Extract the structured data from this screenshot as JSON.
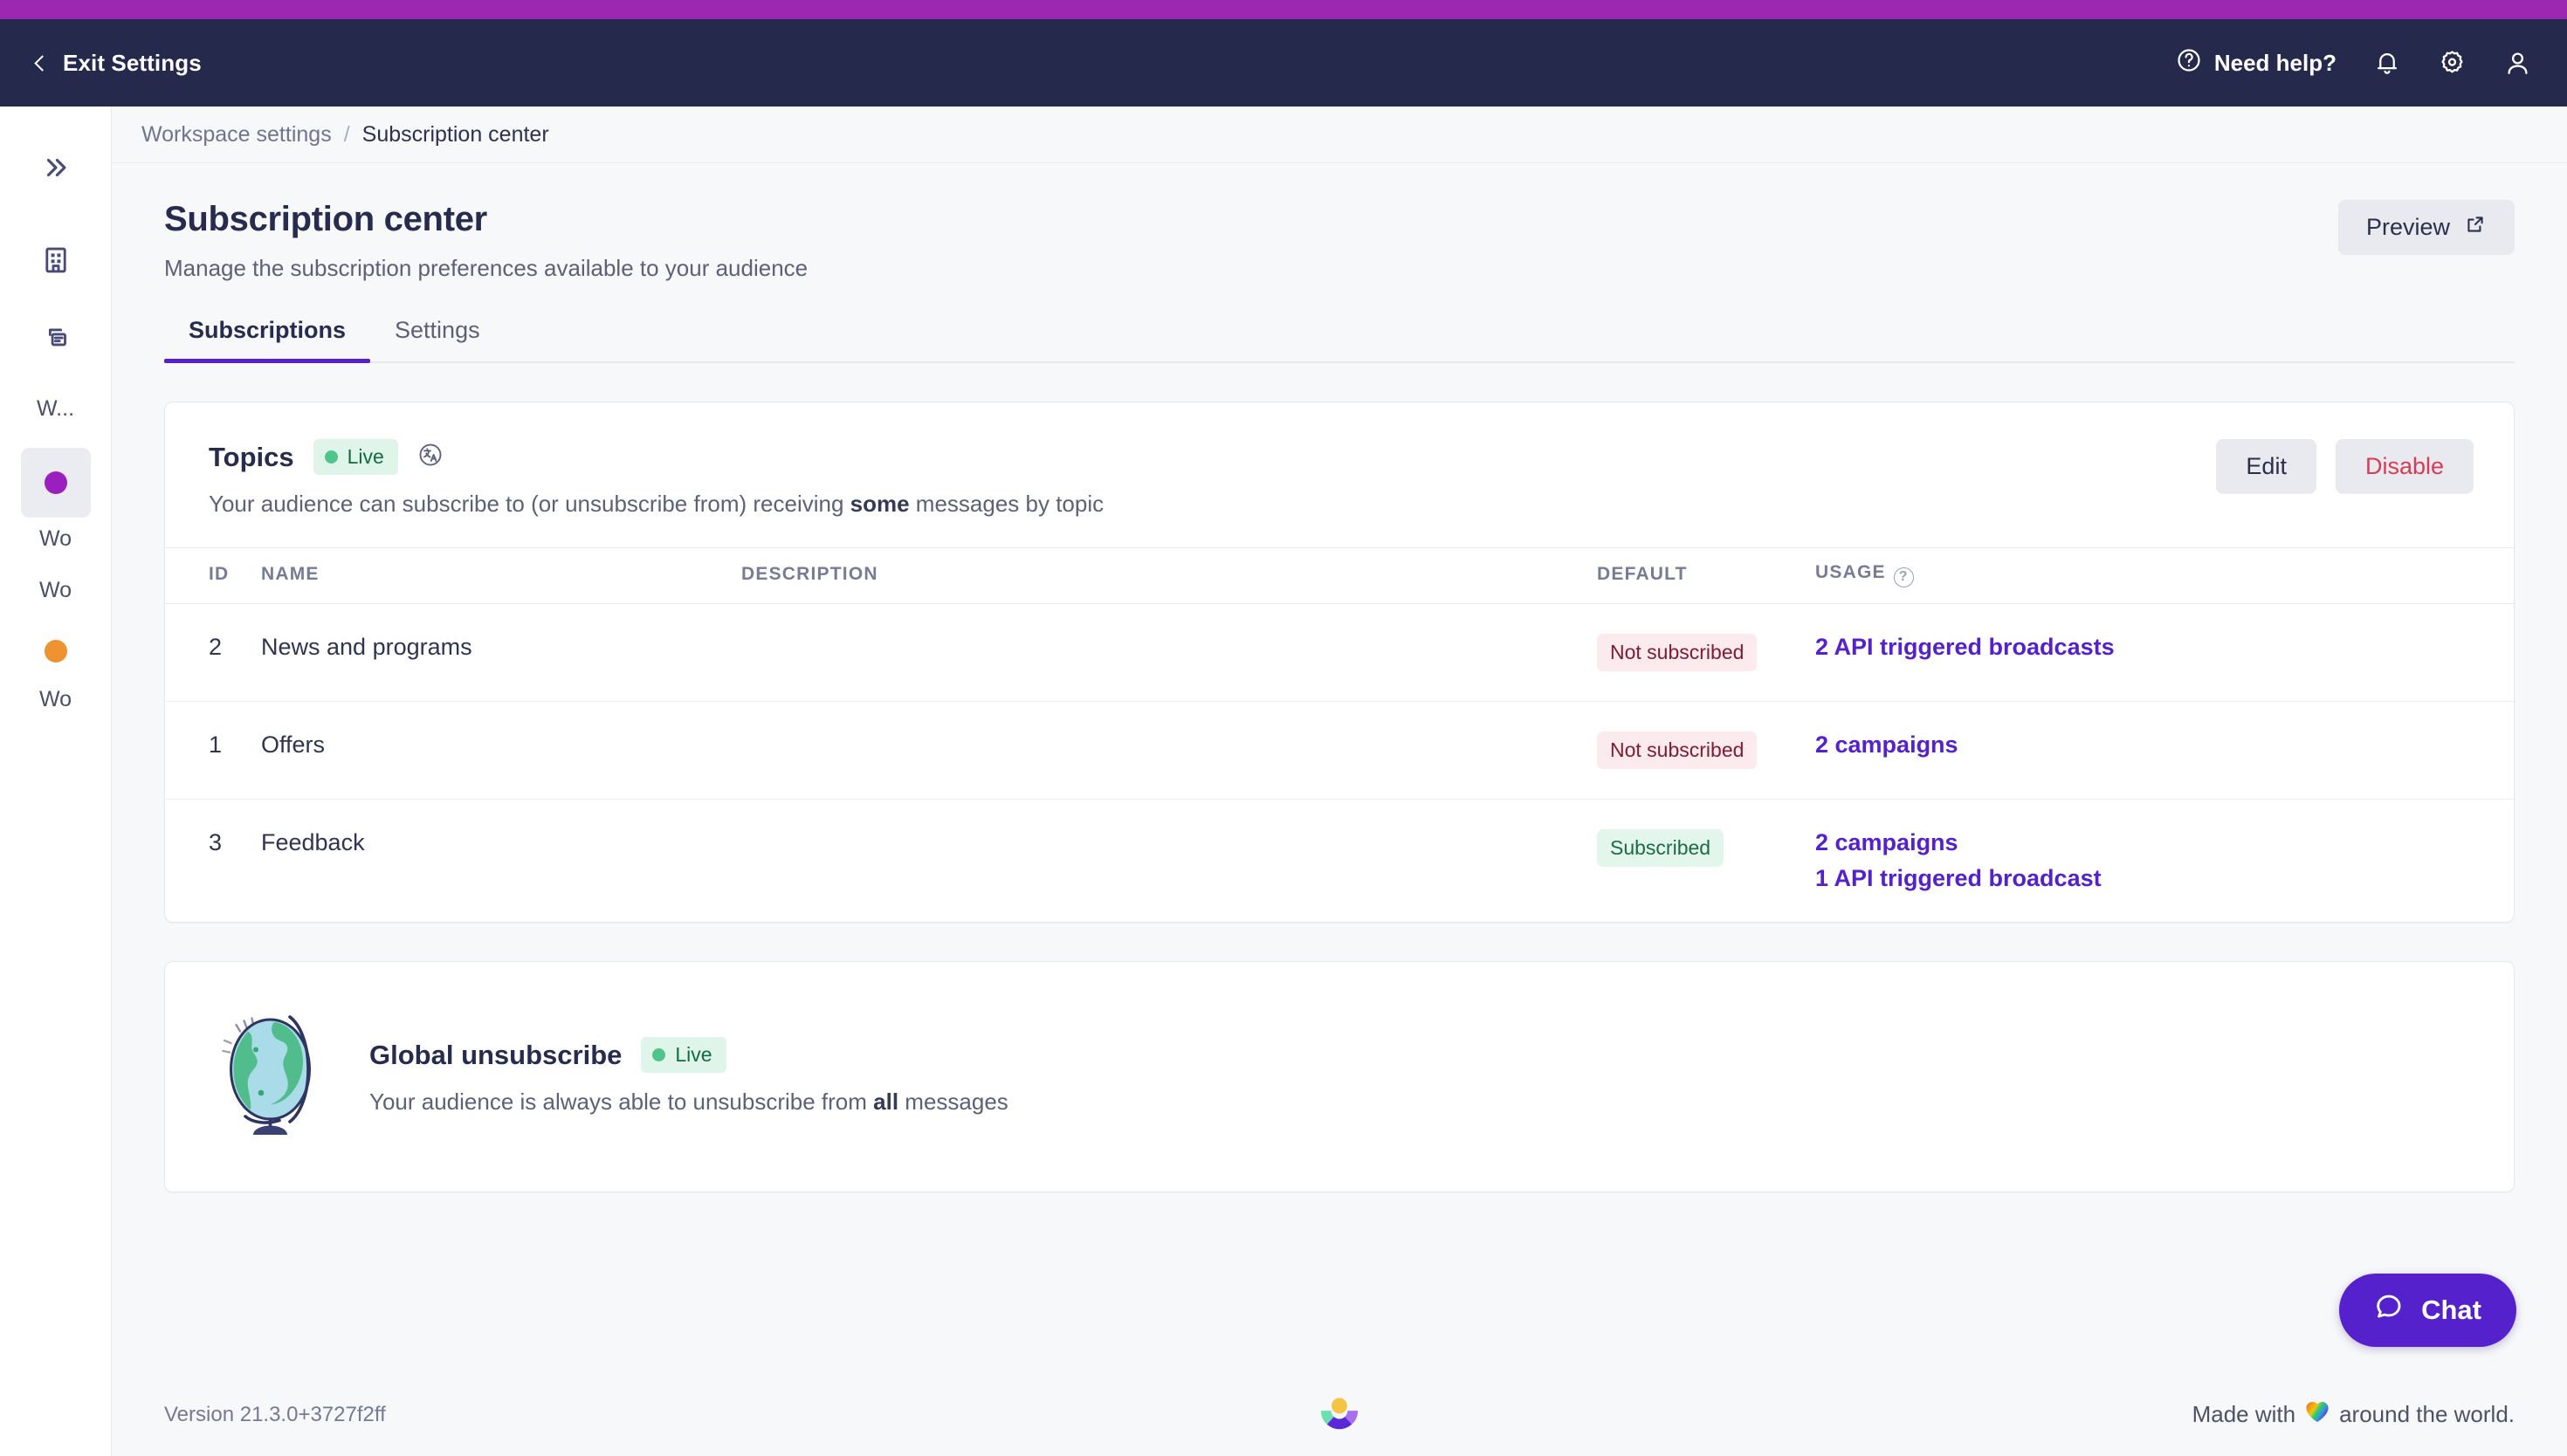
{
  "topnav": {
    "exit_label": "Exit Settings",
    "need_help_label": "Need help?",
    "icons": [
      "help-circle-icon",
      "bell-icon",
      "gear-icon",
      "user-icon"
    ]
  },
  "rail": {
    "collapse_label": "expand-sidebar",
    "items": [
      {
        "name": "building-icon",
        "label": ""
      },
      {
        "name": "copy-document-icon",
        "label": ""
      }
    ],
    "workspaces": [
      {
        "label": "W...",
        "dot": ""
      },
      {
        "label": "",
        "dot": "#9b1fbf",
        "active": true
      },
      {
        "label": "Wo"
      },
      {
        "label": "Wo"
      },
      {
        "label": "",
        "dot": "#ef9331"
      },
      {
        "label": "Wo"
      }
    ]
  },
  "breadcrumb": {
    "parent": "Workspace settings",
    "separator": "/",
    "current": "Subscription center"
  },
  "page": {
    "title": "Subscription center",
    "subtitle": "Manage the subscription preferences available to your audience",
    "preview_label": "Preview"
  },
  "tabs": [
    {
      "label": "Subscriptions",
      "active": true
    },
    {
      "label": "Settings",
      "active": false
    }
  ],
  "topics_card": {
    "title": "Topics",
    "status_badge": "Live",
    "translate_icon": "translate-icon",
    "description_before": "Your audience can subscribe to (or unsubscribe from) receiving ",
    "description_bold": "some",
    "description_after": " messages by topic",
    "edit_label": "Edit",
    "disable_label": "Disable",
    "table": {
      "headers": [
        "ID",
        "NAME",
        "DESCRIPTION",
        "DEFAULT",
        "USAGE"
      ],
      "rows": [
        {
          "id": "2",
          "name": "News and programs",
          "description": "",
          "default": "Not subscribed",
          "default_state": "not",
          "usage": [
            "2 API triggered broadcasts"
          ]
        },
        {
          "id": "1",
          "name": "Offers",
          "description": "",
          "default": "Not subscribed",
          "default_state": "not",
          "usage": [
            "2 campaigns"
          ]
        },
        {
          "id": "3",
          "name": "Feedback",
          "description": "",
          "default": "Subscribed",
          "default_state": "sub",
          "usage": [
            "2 campaigns",
            "1 API triggered broadcast"
          ]
        }
      ]
    }
  },
  "global_card": {
    "illustration": "globe-illustration",
    "title": "Global unsubscribe",
    "status_badge": "Live",
    "description_before": "Your audience is always able to unsubscribe from ",
    "description_bold": "all",
    "description_after": " messages"
  },
  "footer": {
    "version": "Version 21.3.0+3727f2ff",
    "logo": "customerio-logo",
    "made_with_before": "Made with ",
    "made_with_after": " around the world."
  },
  "chat": {
    "label": "Chat",
    "icon": "chat-bubble-icon"
  },
  "colors": {
    "brand_strip": "#9c27b0",
    "topnav": "#252a4d",
    "accent": "#5421cc",
    "danger": "#d93a54",
    "success": "#4fc58b",
    "page_bg": "#f7f8fa"
  }
}
